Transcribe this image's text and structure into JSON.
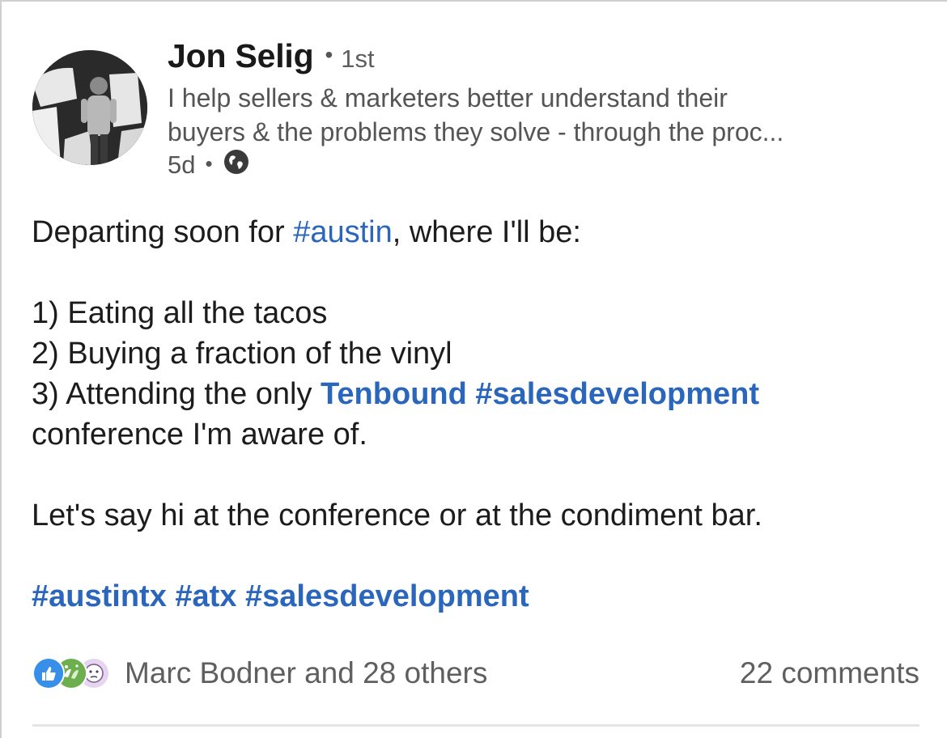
{
  "author": {
    "name": "Jon Selig",
    "degree": "1st",
    "headline_line1": "I help sellers & marketers better understand their",
    "headline_line2": "buyers & the problems they solve - through the proc...",
    "posted_ago": "5d",
    "visibility_icon": "globe-icon"
  },
  "post": {
    "line1_before": "Departing soon for ",
    "line1_tag": "#austin",
    "line1_after": ", where I'll be:",
    "item1": "1) Eating all the tacos",
    "item2": "2) Buying a fraction of the vinyl",
    "item3_before": "3) Attending the only ",
    "item3_mention": "Tenbound",
    "item3_tag": "#salesdevelopment",
    "item3_cont": "conference I'm aware of.",
    "closing": "Let's say hi at the conference or at the condiment bar.",
    "hashtags": [
      "#austintx",
      "#atx",
      "#salesdevelopment"
    ]
  },
  "social": {
    "reaction_icons": [
      "like-icon",
      "celebrate-icon",
      "curious-icon"
    ],
    "reactors_text": "Marc Bodner and 28 others",
    "comments_text": "22 comments"
  },
  "colors": {
    "link": "#2a66bc",
    "secondary_text": "#555555",
    "primary_text": "#1c1c1c"
  }
}
